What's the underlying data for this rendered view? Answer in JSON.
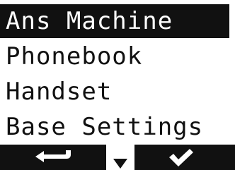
{
  "menu": {
    "selected_index": 0,
    "items": [
      {
        "label": "Ans Machine"
      },
      {
        "label": "Phonebook"
      },
      {
        "label": "Handset"
      },
      {
        "label": "Base Settings"
      }
    ]
  },
  "softkeys": {
    "left_icon": "back-arrow-icon",
    "center_icon": "scroll-down-icon",
    "right_icon": "checkmark-icon"
  },
  "colors": {
    "foreground": "#111111",
    "background": "#ffffff"
  }
}
